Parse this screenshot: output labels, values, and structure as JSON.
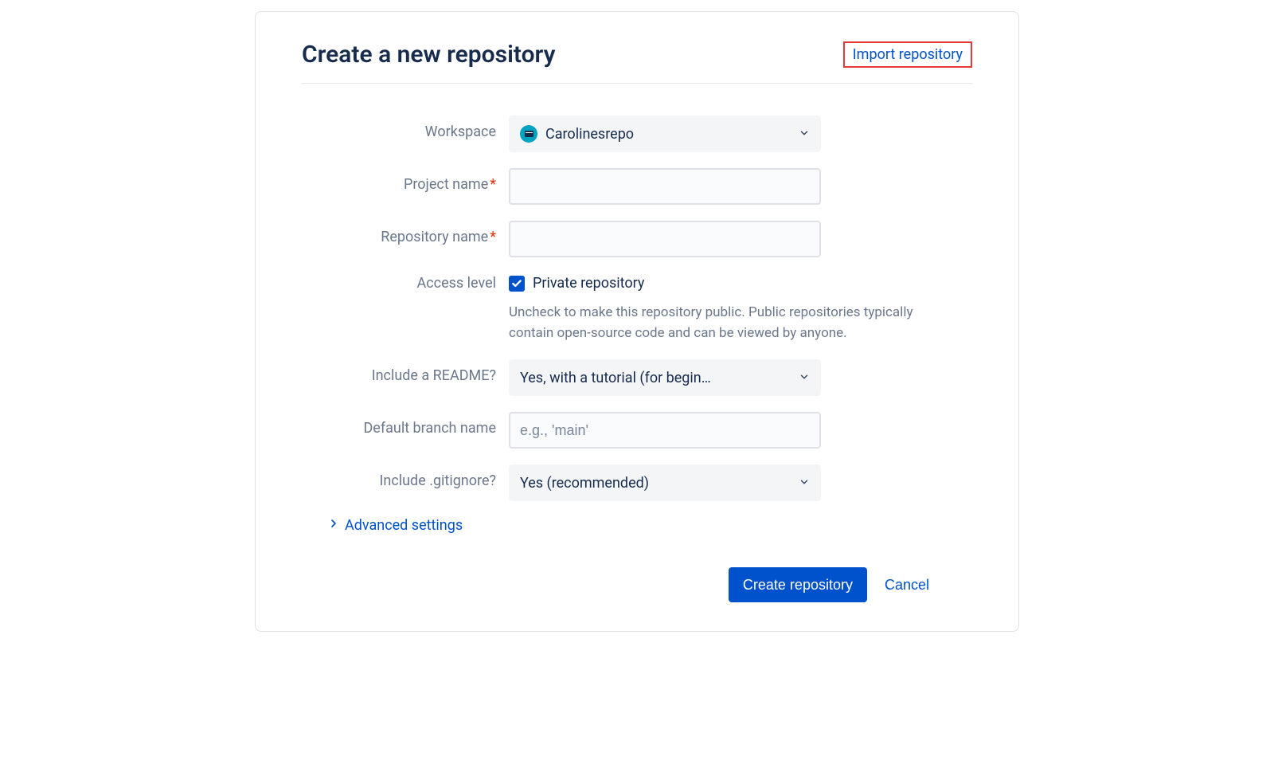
{
  "header": {
    "title": "Create a new repository",
    "import_link": "Import repository"
  },
  "form": {
    "workspace": {
      "label": "Workspace",
      "value": "Carolinesrepo"
    },
    "project_name": {
      "label": "Project name",
      "value": ""
    },
    "repo_name": {
      "label": "Repository name",
      "value": ""
    },
    "access": {
      "label": "Access level",
      "checkbox_label": "Private repository",
      "checked": true,
      "help": "Uncheck to make this repository public. Public repositories typically contain open-source code and can be viewed by anyone."
    },
    "readme": {
      "label": "Include a README?",
      "value": "Yes, with a tutorial (for begin…"
    },
    "default_branch": {
      "label": "Default branch name",
      "placeholder": "e.g., 'main'",
      "value": ""
    },
    "gitignore": {
      "label": "Include .gitignore?",
      "value": "Yes (recommended)"
    },
    "advanced": "Advanced settings"
  },
  "footer": {
    "create": "Create repository",
    "cancel": "Cancel"
  }
}
